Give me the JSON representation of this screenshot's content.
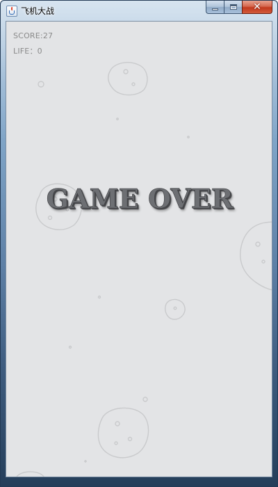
{
  "window": {
    "title": "飞机大战",
    "icon": "java-cup-icon",
    "controls": {
      "minimize_icon": "minimize-icon",
      "maximize_icon": "maximize-icon",
      "close_icon": "close-icon",
      "close_glyph": "✕"
    }
  },
  "hud": {
    "score": "SCORE:27",
    "life": "LIFE：0"
  },
  "game": {
    "message": "GAME OVER",
    "background_color": "#e3e4e6",
    "text_color": "#6d6f73"
  }
}
